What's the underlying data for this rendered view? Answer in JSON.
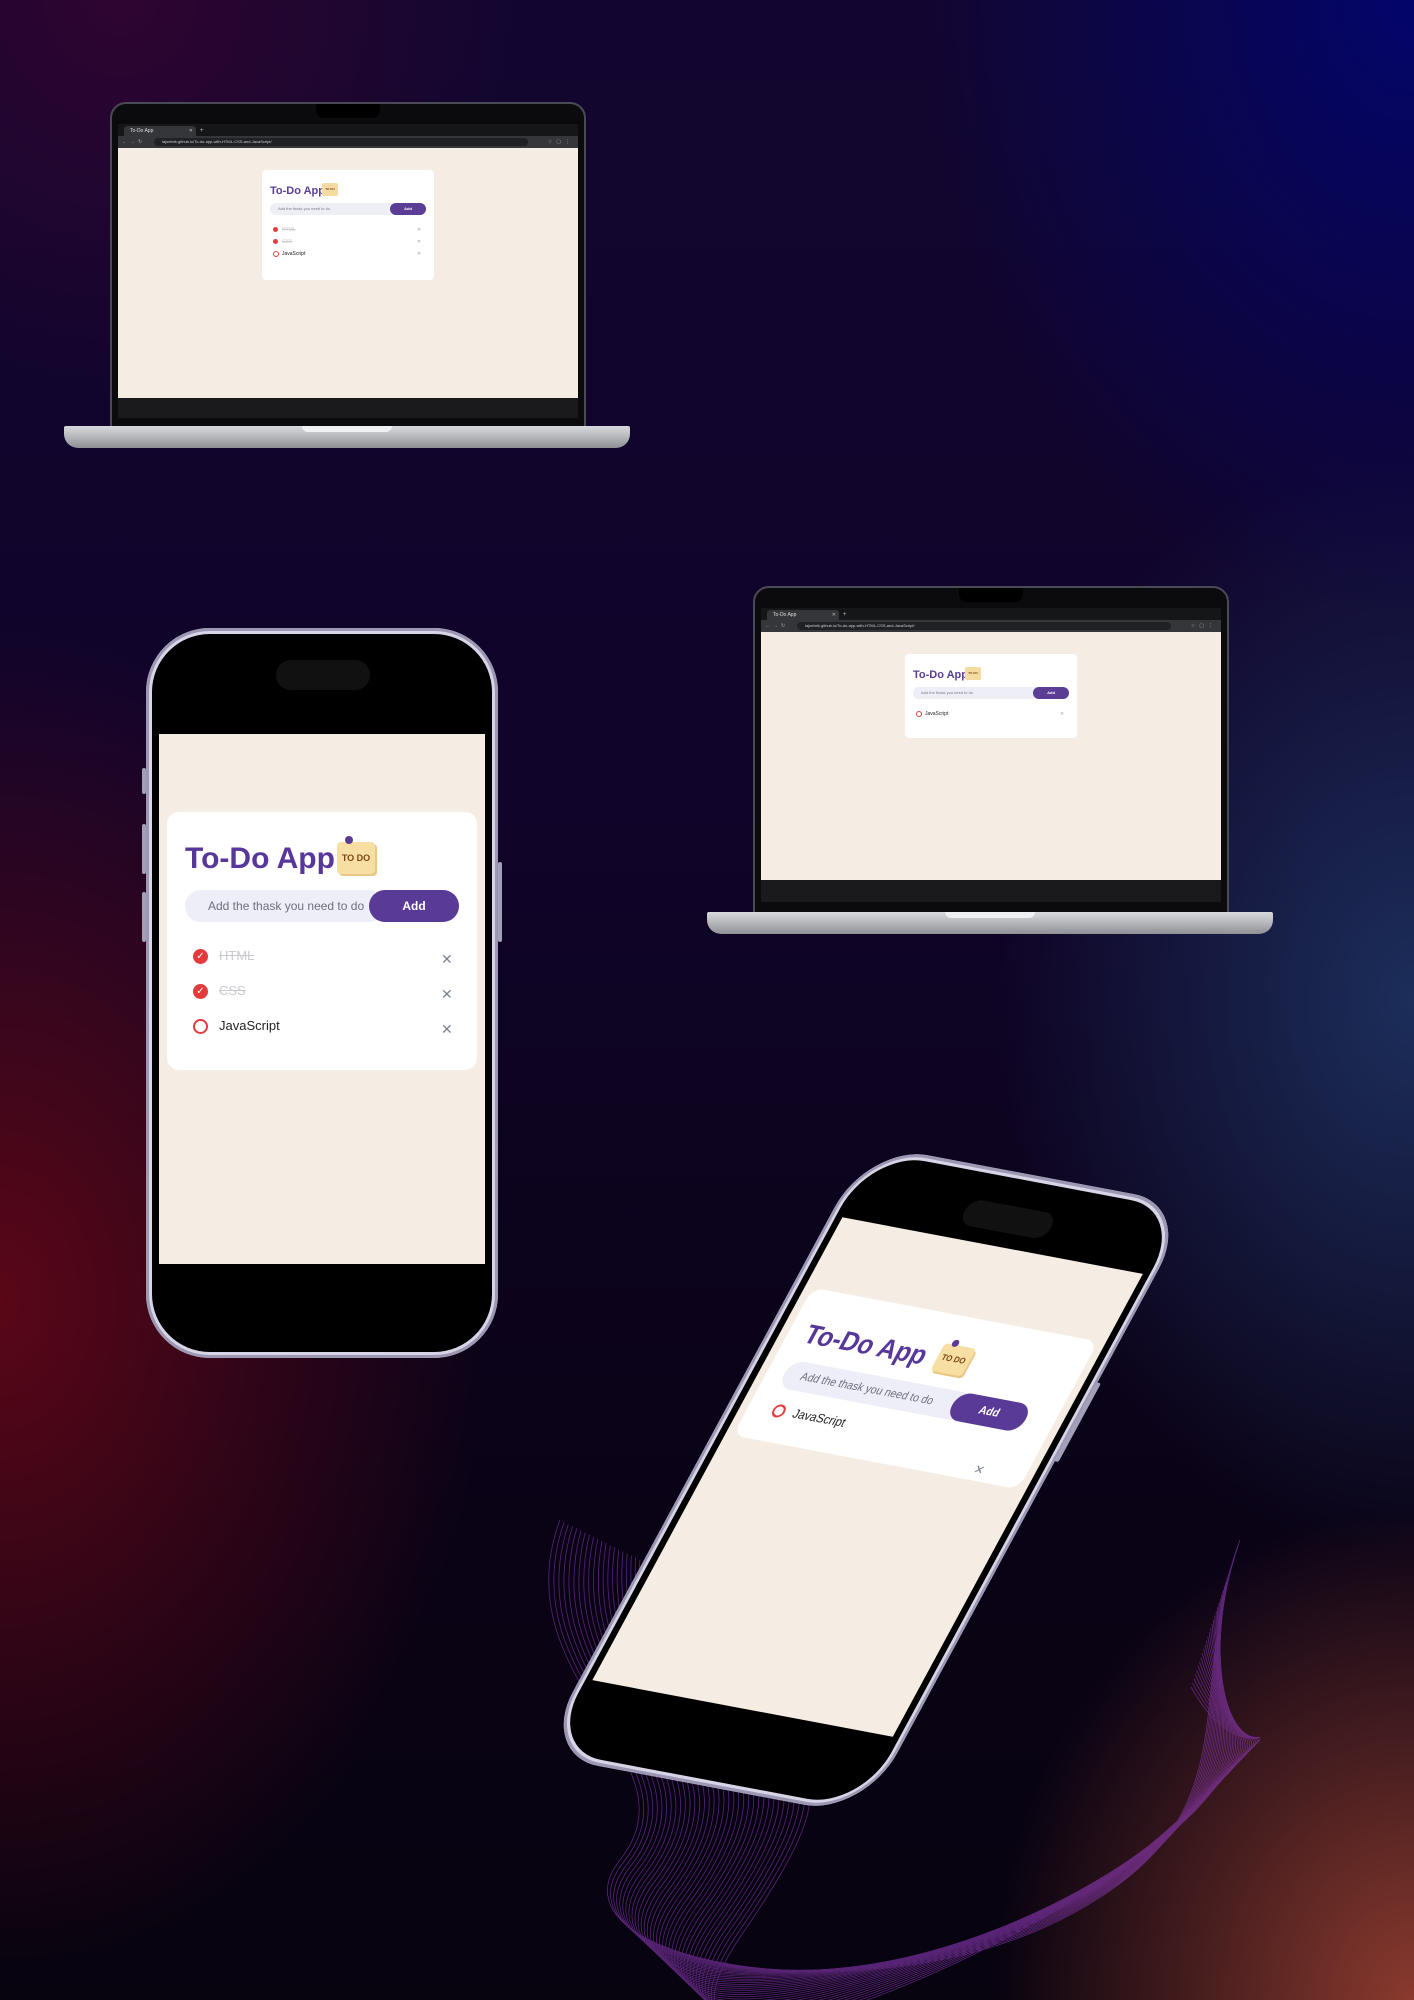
{
  "app": {
    "title": "To-Do App",
    "image_label": "TO DO",
    "input_placeholder": "Add the thask you need to do",
    "add_button": "Add",
    "remove_symbol": "✕",
    "check_symbol": "✓",
    "tasks_full": [
      {
        "label": "HTML",
        "done": true
      },
      {
        "label": "CSS",
        "done": true
      },
      {
        "label": "JavaScript",
        "done": false
      }
    ],
    "tasks_single": [
      {
        "label": "JavaScript",
        "done": false
      }
    ]
  },
  "browser": {
    "tab_title": "To-Do App",
    "new_tab": "+",
    "url": "lajoebrik.github.io/To-do-app-with-HTML-CSS-and-JavaScript/"
  },
  "colors": {
    "accent": "#5a3a97",
    "check": "#e33b3b",
    "page_bg": "#f5ede3",
    "card_bg": "#ffffff"
  }
}
